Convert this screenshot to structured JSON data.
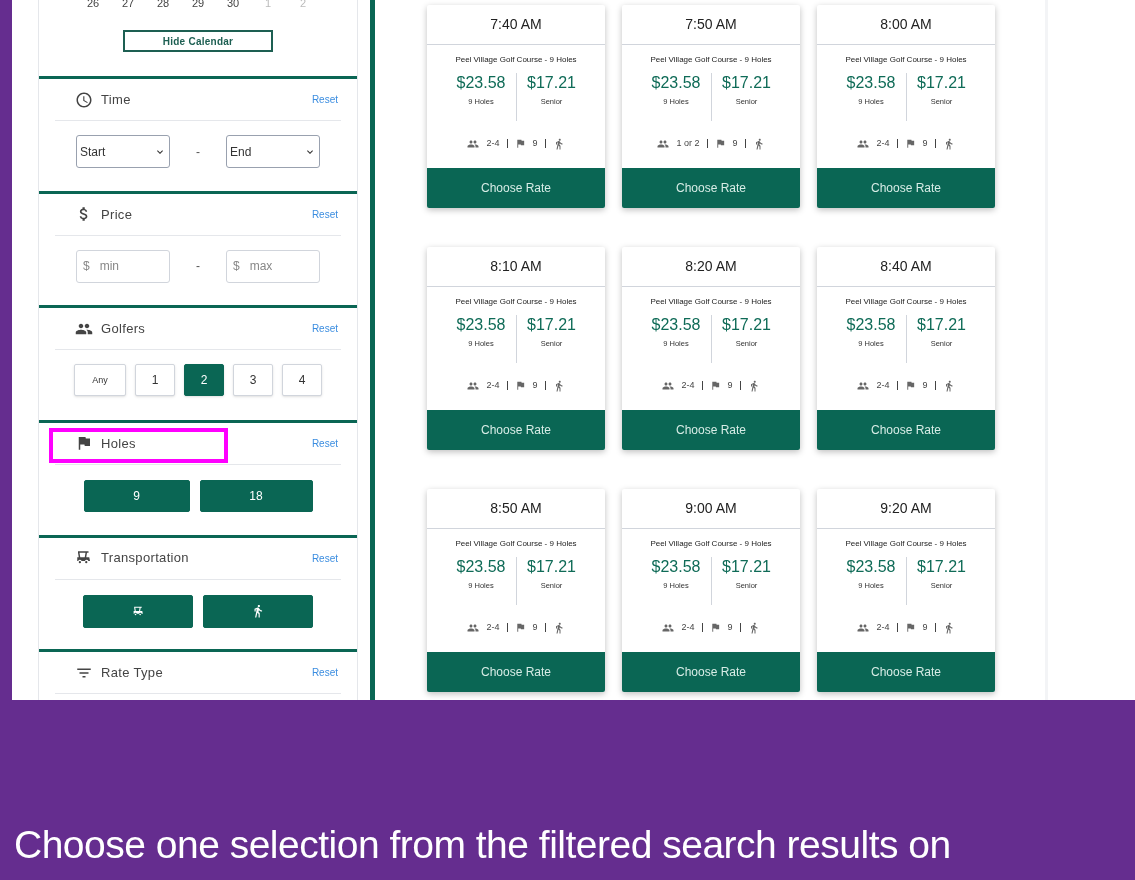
{
  "calendar": {
    "days": [
      {
        "label": "26",
        "in_month": true
      },
      {
        "label": "27",
        "in_month": true
      },
      {
        "label": "28",
        "in_month": true
      },
      {
        "label": "29",
        "in_month": true
      },
      {
        "label": "30",
        "in_month": true
      },
      {
        "label": "1",
        "in_month": false
      },
      {
        "label": "2",
        "in_month": false
      }
    ],
    "hide_button": "Hide Calendar"
  },
  "filters": [
    {
      "kind": "time",
      "title": "Time",
      "reset": "Reset",
      "start": "Start",
      "separator": "-",
      "end": "End"
    },
    {
      "kind": "price",
      "title": "Price",
      "reset": "Reset",
      "min_prefix": "$",
      "min_placeholder": "min",
      "separator": "-",
      "max_prefix": "$",
      "max_placeholder": "max"
    },
    {
      "kind": "golfers",
      "title": "Golfers",
      "reset": "Reset",
      "options": [
        {
          "label": "Any",
          "selected": false
        },
        {
          "label": "1",
          "selected": false
        },
        {
          "label": "2",
          "selected": true
        },
        {
          "label": "3",
          "selected": false
        },
        {
          "label": "4",
          "selected": false
        }
      ]
    },
    {
      "kind": "holes",
      "title": "Holes",
      "reset": "Reset",
      "highlighted": true,
      "options": [
        {
          "label": "9",
          "selected": true
        },
        {
          "label": "18",
          "selected": true
        }
      ]
    },
    {
      "kind": "transportation",
      "title": "Transportation",
      "reset": "Reset",
      "options": [
        {
          "kind": "cart",
          "selected": true
        },
        {
          "kind": "walk",
          "selected": true
        }
      ]
    },
    {
      "kind": "rate_type",
      "title": "Rate Type",
      "reset": "Reset"
    }
  ],
  "tee_times": [
    {
      "time": "7:40 AM",
      "course": "Peel Village Golf Course - 9 Holes",
      "rates": [
        {
          "price": "$23.58",
          "label": "9 Holes"
        },
        {
          "price": "$17.21",
          "label": "Senior"
        }
      ],
      "golfers": "2-4",
      "holes": "9",
      "button": "Choose Rate"
    },
    {
      "time": "7:50 AM",
      "course": "Peel Village Golf Course - 9 Holes",
      "rates": [
        {
          "price": "$23.58",
          "label": "9 Holes"
        },
        {
          "price": "$17.21",
          "label": "Senior"
        }
      ],
      "golfers": "1 or 2",
      "holes": "9",
      "button": "Choose Rate"
    },
    {
      "time": "8:00 AM",
      "course": "Peel Village Golf Course - 9 Holes",
      "rates": [
        {
          "price": "$23.58",
          "label": "9 Holes"
        },
        {
          "price": "$17.21",
          "label": "Senior"
        }
      ],
      "golfers": "2-4",
      "holes": "9",
      "button": "Choose Rate"
    },
    {
      "time": "8:10 AM",
      "course": "Peel Village Golf Course - 9 Holes",
      "rates": [
        {
          "price": "$23.58",
          "label": "9 Holes"
        },
        {
          "price": "$17.21",
          "label": "Senior"
        }
      ],
      "golfers": "2-4",
      "holes": "9",
      "button": "Choose Rate"
    },
    {
      "time": "8:20 AM",
      "course": "Peel Village Golf Course - 9 Holes",
      "rates": [
        {
          "price": "$23.58",
          "label": "9 Holes"
        },
        {
          "price": "$17.21",
          "label": "Senior"
        }
      ],
      "golfers": "2-4",
      "holes": "9",
      "button": "Choose Rate"
    },
    {
      "time": "8:40 AM",
      "course": "Peel Village Golf Course - 9 Holes",
      "rates": [
        {
          "price": "$23.58",
          "label": "9 Holes"
        },
        {
          "price": "$17.21",
          "label": "Senior"
        }
      ],
      "golfers": "2-4",
      "holes": "9",
      "button": "Choose Rate"
    },
    {
      "time": "8:50 AM",
      "course": "Peel Village Golf Course - 9 Holes",
      "rates": [
        {
          "price": "$23.58",
          "label": "9 Holes"
        },
        {
          "price": "$17.21",
          "label": "Senior"
        }
      ],
      "golfers": "2-4",
      "holes": "9",
      "button": "Choose Rate"
    },
    {
      "time": "9:00 AM",
      "course": "Peel Village Golf Course - 9 Holes",
      "rates": [
        {
          "price": "$23.58",
          "label": "9 Holes"
        },
        {
          "price": "$17.21",
          "label": "Senior"
        }
      ],
      "golfers": "2-4",
      "holes": "9",
      "button": "Choose Rate"
    },
    {
      "time": "9:20 AM",
      "course": "Peel Village Golf Course - 9 Holes",
      "rates": [
        {
          "price": "$23.58",
          "label": "9 Holes"
        },
        {
          "price": "$17.21",
          "label": "Senior"
        }
      ],
      "golfers": "2-4",
      "holes": "9",
      "button": "Choose Rate"
    }
  ],
  "caption": "Choose one selection from the filtered search results on"
}
